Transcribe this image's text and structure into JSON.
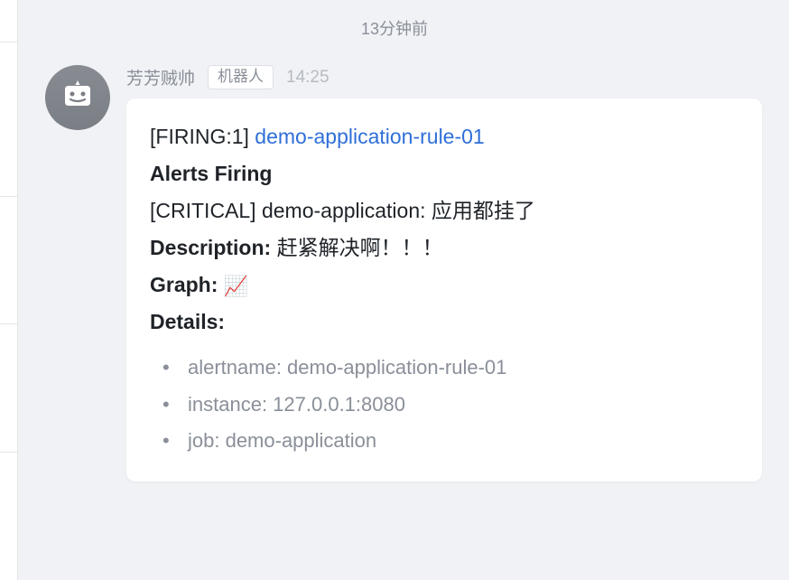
{
  "top_timestamp": "13分钟前",
  "sender": {
    "name": "芳芳贼帅",
    "bot_label": "机器人",
    "time": "14:25"
  },
  "alert": {
    "firing_prefix": "[FIRING:1] ",
    "rule_link": "demo-application-rule-01",
    "heading": "Alerts Firing",
    "critical_line": "[CRITICAL] demo-application: 应用都挂了",
    "description_label": "Description: ",
    "description_value": "赶紧解决啊！！！",
    "graph_label": "Graph: ",
    "graph_emoji": "📈",
    "details_label": "Details:",
    "details": [
      {
        "key": "alertname",
        "value": "demo-application-rule-01"
      },
      {
        "key": "instance",
        "value": "127.0.0.1:8080"
      },
      {
        "key": "job",
        "value": "demo-application"
      }
    ]
  }
}
